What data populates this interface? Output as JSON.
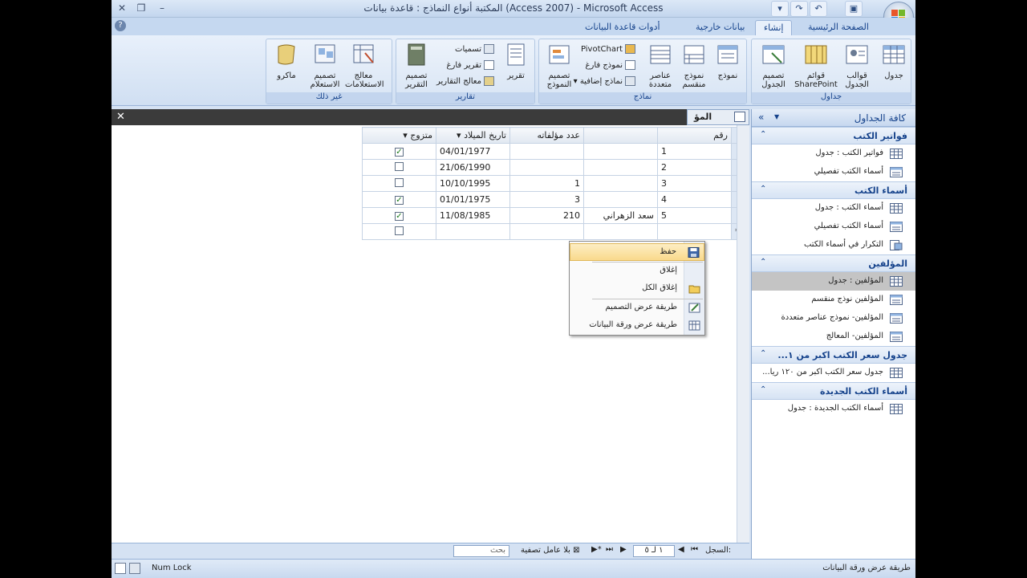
{
  "window": {
    "title": "المكتبة أنواع النماذج : قاعدة بيانات (Access 2007) - Microsoft Access"
  },
  "tabs": [
    "الصفحة الرئيسية",
    "إنشاء",
    "بيانات خارجية",
    "أدوات قاعدة البيانات"
  ],
  "active_tab": "إنشاء",
  "ribbon": {
    "tables_group": {
      "label": "جداول",
      "table": "جدول",
      "table_templates": "قوالب الجدول",
      "sharepoint_lists": "قوائم SharePoint",
      "table_design": "تصميم الجدول"
    },
    "forms_group": {
      "label": "نماذج",
      "form": "نموذج",
      "split_form": "نموذج منقسم",
      "multiple_items": "عناصر متعددة",
      "pivotchart": "PivotChart",
      "blank_form": "نموذج فارغ",
      "more_forms": "نماذج إضافية",
      "form_design": "تصميم النموذج"
    },
    "reports_group": {
      "label": "تقارير",
      "report": "تقرير",
      "labels": "تسميات",
      "blank_report": "تقرير فارغ",
      "report_wizard": "معالج التقارير",
      "report_design": "تصميم التقرير"
    },
    "other_group": {
      "label": "غير ذلك",
      "query_wizard": "معالج الاستعلامات",
      "query_design": "تصميم الاستعلام",
      "macro": "ماكرو"
    }
  },
  "nav_pane": {
    "title": "كافة الجداول",
    "groups": [
      {
        "name": "فواتير الكتب",
        "items": [
          {
            "label": "فواتير الكتب : جدول",
            "icon": "table-icon"
          },
          {
            "label": "أسماء الكتب تفصيلي",
            "icon": "form-icon"
          }
        ]
      },
      {
        "name": "أسماء الكتب",
        "items": [
          {
            "label": "أسماء الكتب : جدول",
            "icon": "table-icon"
          },
          {
            "label": "أسماء الكتب تفصيلي",
            "icon": "form-icon"
          },
          {
            "label": "التكرار في أسماء الكتب",
            "icon": "query-icon"
          }
        ]
      },
      {
        "name": "المؤلفين",
        "items": [
          {
            "label": "المؤلفين : جدول",
            "icon": "table-icon"
          },
          {
            "label": "المؤلفين نوذج منقسم",
            "icon": "form-icon"
          },
          {
            "label": "المؤلفين- نموذج عناصر متعددة",
            "icon": "form-icon"
          },
          {
            "label": "المؤلفين- المعالج",
            "icon": "form-icon"
          }
        ]
      },
      {
        "name": "جدول سعر الكتب اكبر من ١...",
        "items": [
          {
            "label": "جدول سعر الكتب اكبر من ١٢٠ ريا...",
            "icon": "table-icon"
          }
        ]
      },
      {
        "name": "أسماء الكتب الجديدة",
        "items": [
          {
            "label": "أسماء الكتب الجديدة : جدول",
            "icon": "table-icon"
          }
        ]
      }
    ]
  },
  "doc_tab": {
    "label": "المؤ"
  },
  "grid": {
    "columns": [
      "متزوج",
      "تاريخ الميلاد",
      "عدد مؤلفاته",
      "",
      "رقم"
    ],
    "rows": [
      {
        "married": true,
        "birth": "04/01/1977",
        "count": "",
        "name": "",
        "id": "1"
      },
      {
        "married": false,
        "birth": "21/06/1990",
        "count": "",
        "name": "",
        "id": "2"
      },
      {
        "married": false,
        "birth": "10/10/1995",
        "count": "1",
        "name": "",
        "id": "3"
      },
      {
        "married": true,
        "birth": "01/01/1975",
        "count": "3",
        "name": "",
        "id": "4"
      },
      {
        "married": true,
        "birth": "11/08/1985",
        "count": "210",
        "name": "سعد الزهراني",
        "id": "5"
      }
    ],
    "new_row_marker": "*"
  },
  "context_menu": {
    "items": [
      {
        "label": "حفظ",
        "icon": "save-icon"
      },
      {
        "label": "إغلاق",
        "icon": "close-doc-icon"
      },
      {
        "label": "إغلاق الكل",
        "icon": "folder-icon"
      },
      {
        "label": "طريقة عرض التصميم",
        "icon": "design-view-icon"
      },
      {
        "label": "طريقة عرض ورقة البيانات",
        "icon": "datasheet-view-icon"
      }
    ]
  },
  "record_nav": {
    "label": "السجل:",
    "current": "١ لـ ٥",
    "filter": "بلا عامل تصفية",
    "search": "بحث"
  },
  "status": {
    "left": "طريقة عرض ورقة البيانات",
    "numlock": "Num Lock"
  }
}
